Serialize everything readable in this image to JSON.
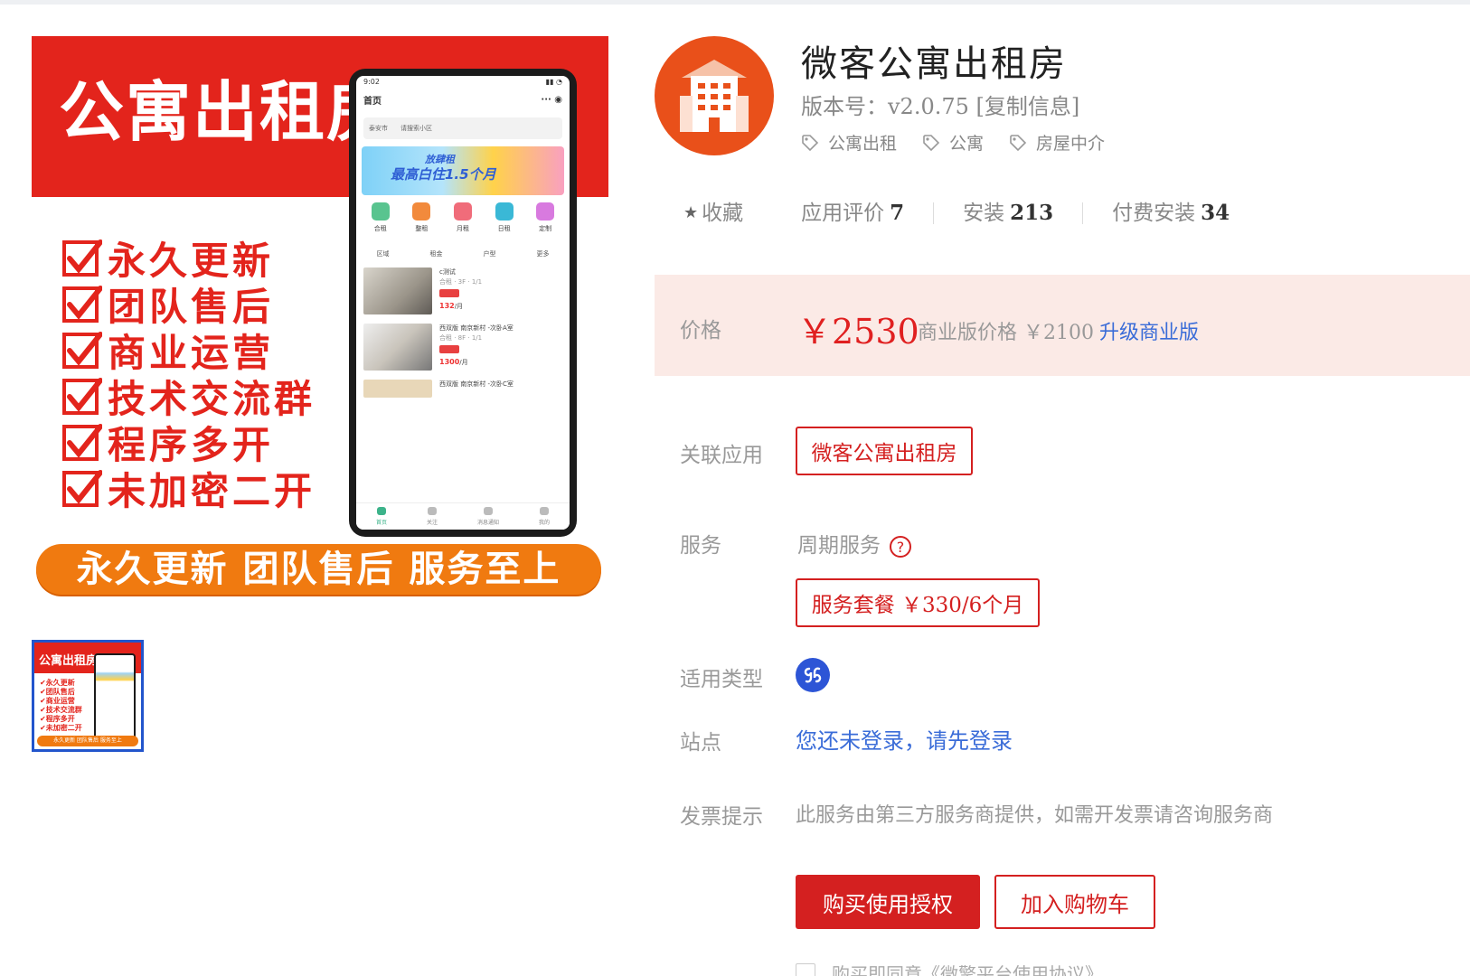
{
  "banner": {
    "title": "公寓出租房",
    "features": [
      "永久更新",
      "团队售后",
      "商业运营",
      "技术交流群",
      "程序多开",
      "未加密二开"
    ],
    "pill": "永久更新 团队售后 服务至上",
    "accent": "#e3241c",
    "pill_color": "#f07a10"
  },
  "phone": {
    "time": "9:02",
    "header": "首页",
    "city": "泰安市",
    "search_placeholder": "请搜索小区",
    "ad_line1": "放肆租",
    "ad_line2": "最高白住1.5个月",
    "shortcuts": [
      "合租",
      "整租",
      "月租",
      "日租",
      "定制"
    ],
    "filters": [
      "区域",
      "租金",
      "户型",
      "更多"
    ],
    "listings": [
      {
        "title": "c测试",
        "price": "132",
        "unit": "/月"
      },
      {
        "title": "西双版 南京新村 -次卧A室",
        "price": "1300",
        "unit": "/月"
      },
      {
        "title": "西双版 南京新村 -次卧C室",
        "price": "",
        "unit": ""
      }
    ],
    "nav": [
      "首页",
      "关注",
      "消息通知",
      "我的"
    ]
  },
  "thumbnail": {
    "title": "公寓出租房",
    "lines": [
      "✔永久更新",
      "✔团队售后",
      "✔商业运营",
      "✔技术交流群",
      "✔程序多开",
      "✔未加密二开"
    ],
    "pill": "永久更新 团队售后 服务至上"
  },
  "app": {
    "name": "微客公寓出租房",
    "version": "版本号：v2.0.75 [复制信息]",
    "tags": [
      "公寓出租",
      "公寓",
      "房屋中介"
    ],
    "logo_icon": "building-icon",
    "logo_color": "#e9501a"
  },
  "stats": {
    "favorite": "收藏",
    "rating_label": "应用评价",
    "rating_value": "7",
    "install_label": "安装",
    "install_value": "213",
    "paid_label": "付费安装",
    "paid_value": "34"
  },
  "price": {
    "label": "价格",
    "main": "￥2530",
    "business_label": "商业版价格 ￥2100",
    "upgrade": "升级商业版"
  },
  "related": {
    "label": "关联应用",
    "value": "微客公寓出租房"
  },
  "service": {
    "label": "服务",
    "type": "周期服务",
    "package": "服务套餐  ￥330/6个月"
  },
  "platform": {
    "label": "适用类型",
    "icon": "mini-program-icon"
  },
  "site": {
    "label": "站点",
    "link": "您还未登录，请先登录"
  },
  "invoice": {
    "label": "发票提示",
    "text": "此服务由第三方服务商提供，如需开发票请咨询服务商"
  },
  "actions": {
    "buy": "购买使用授权",
    "cart": "加入购物车",
    "agree": "购买即同意《微擎平台使用协议》"
  },
  "colors": {
    "primary": "#d42020",
    "link": "#3a6cd8",
    "price_bg": "#fbeae6"
  }
}
